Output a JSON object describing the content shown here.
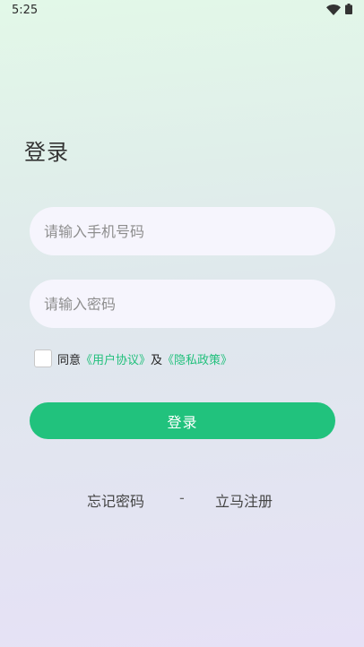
{
  "status_bar": {
    "time": "5:25"
  },
  "page": {
    "title": "登录"
  },
  "form": {
    "phone_placeholder": "请输入手机号码",
    "phone_value": "",
    "password_placeholder": "请输入密码",
    "password_value": "",
    "agreement": {
      "checked": false,
      "prefix": "同意",
      "user_agreement": "《用户协议》",
      "conjunction": "及",
      "privacy_policy": "《隐私政策》"
    },
    "login_label": "登录"
  },
  "links": {
    "forgot_password": "忘记密码",
    "separator": "-",
    "register": "立马注册"
  },
  "colors": {
    "accent": "#21c27d",
    "link": "#21c07c",
    "field_background": "#f6f5fd"
  }
}
